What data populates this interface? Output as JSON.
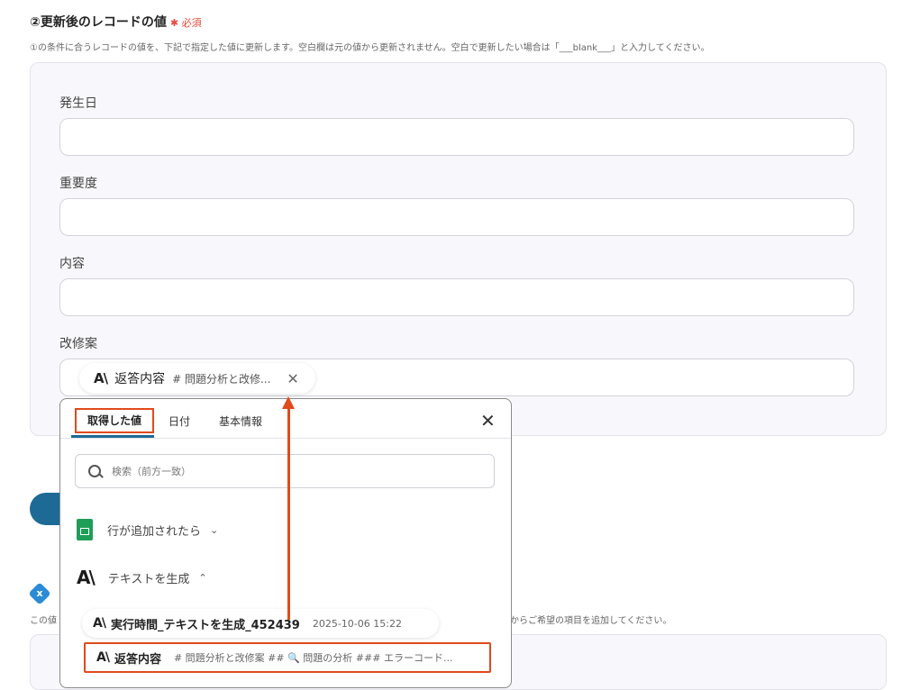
{
  "section": {
    "title": "②更新後のレコードの値",
    "required_mark": "✱ 必須",
    "description": "①の条件に合うレコードの値を、下記で指定した値に更新します。空白欄は元の値から更新されません。空白で更新したい場合は「___blank___」と入力してください。"
  },
  "fields": [
    {
      "label": "発生日",
      "value": ""
    },
    {
      "label": "重要度",
      "value": ""
    },
    {
      "label": "内容",
      "value": ""
    },
    {
      "label": "改修案",
      "value": ""
    }
  ],
  "chip": {
    "icon": "anthropic-icon",
    "name": "返答内容",
    "preview": "# 問題分析と改修...",
    "close": "✕"
  },
  "background": {
    "icon": "x",
    "text_left": "この値",
    "text_right": "からご希望の項目を追加してください。"
  },
  "popup": {
    "tabs": [
      "取得した値",
      "日付",
      "基本情報"
    ],
    "close": "✕",
    "search_placeholder": "検索（前方一致）",
    "groups": [
      {
        "icon": "google-sheets-icon",
        "label": "行が追加されたら",
        "chevron": "⌄"
      },
      {
        "icon": "anthropic-icon",
        "label": "テキストを生成",
        "chevron": "⌃"
      }
    ],
    "items": [
      {
        "icon": "anthropic-icon",
        "name": "実行時間_テキストを生成_452439",
        "value": "2025-10-06 15:22"
      },
      {
        "icon": "anthropic-icon",
        "name": "返答内容",
        "value": "# 問題分析と改修案 ## 🔍 問題の分析 ### エラーコード..."
      }
    ]
  },
  "colors": {
    "accent": "#1d6a96",
    "highlight": "#e04a1c",
    "required": "#e5483d",
    "sheets": "#1e9e58"
  }
}
